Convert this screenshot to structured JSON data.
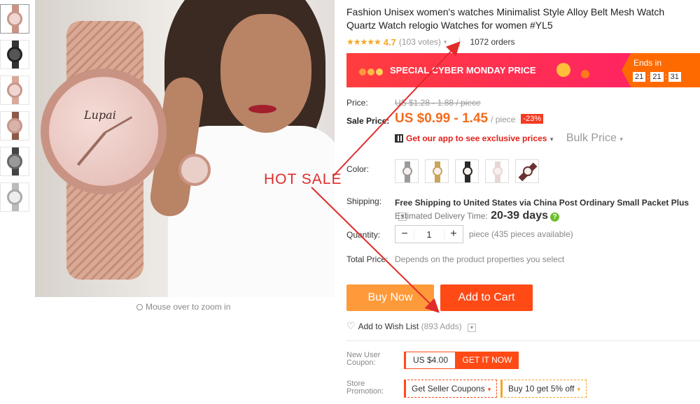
{
  "gallery": {
    "thumbs": [
      "thumb-1",
      "thumb-2",
      "thumb-3",
      "thumb-4",
      "thumb-5",
      "thumb-6"
    ],
    "main_brand_text": "Lupai",
    "zoom_hint": "Mouse over to zoom in"
  },
  "overlay": {
    "hot_sale": "HOT  SALE"
  },
  "product": {
    "title": "Fashion Unisex women's watches Minimalist Style Alloy Belt Mesh Watch Quartz Watch relogio Watches for women #YL5",
    "stars": "★★★★★",
    "rating": "4.7",
    "votes": "(103 votes)",
    "orders": "1072 orders"
  },
  "promo": {
    "label": "SPECIAL CYBER MONDAY PRICE",
    "ends_label": "Ends in",
    "hours": "21",
    "minutes": "21",
    "seconds": "31"
  },
  "pricing": {
    "price_label": "Price:",
    "original_price": "US $1.28 - 1.88 / piece",
    "sale_label": "Sale Price:",
    "sale_price": "US $0.99 - 1.45",
    "unit": "/ piece",
    "discount": "-23%",
    "app_link": "Get our app to see exclusive prices",
    "bulk_price": "Bulk Price"
  },
  "color": {
    "label": "Color:",
    "swatches": [
      "#9a9a9a",
      "#c9a55a",
      "#2a2a2a",
      "#e8d6d4",
      "#6a3232"
    ]
  },
  "shipping": {
    "label": "Shipping:",
    "main": "Free Shipping to United States via China Post Ordinary Small Packet Plus",
    "sub_label": "Estimated Delivery Time:",
    "days": "20-39 days"
  },
  "quantity": {
    "label": "Quantity:",
    "value": "1",
    "minus": "−",
    "plus": "+",
    "available": "piece (435 pieces available)"
  },
  "total": {
    "label": "Total Price:",
    "value": "Depends on the product properties you select"
  },
  "actions": {
    "buy_now": "Buy Now",
    "add_to_cart": "Add to Cart",
    "wishlist": "Add to Wish List",
    "wishlist_count": "(893 Adds)"
  },
  "coupons": {
    "new_user_label_1": "New User",
    "new_user_label_2": "Coupon:",
    "coupon_amount": "US $4.00",
    "get_it_now": "GET IT NOW",
    "store_label_1": "Store",
    "store_label_2": "Promotion:",
    "seller_coupons": "Get Seller Coupons",
    "bundle_offer": "Buy 10 get 5% off"
  },
  "colors": {
    "accent": "#ff4a16",
    "price": "#f36c1f",
    "hot_sale": "#e12b2b"
  }
}
